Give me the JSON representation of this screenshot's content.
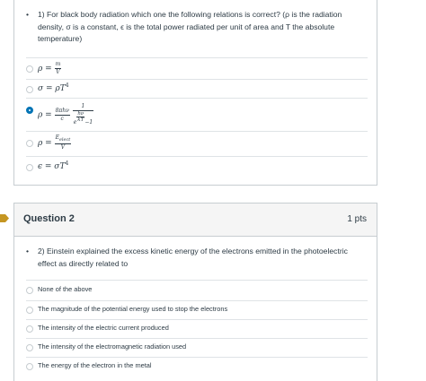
{
  "question1": {
    "bullet": "•",
    "text": "1) For black body radiation which one the following relations is correct? (ρ is the radiation density, σ is a constant, ϵ is the total power radiated per unit of area and T the absolute temperature)",
    "options": [
      {
        "lhs": "ρ =",
        "num": "m",
        "den": "V",
        "selected": false
      },
      {
        "expr": "σ = ρT",
        "sup": "4",
        "selected": false
      },
      {
        "lhs": "ρ =",
        "num1": "8πhν",
        "den1": "c",
        "num2": "1",
        "den2_exp_num": "hν",
        "den2_exp_den": "kT",
        "den2_base": "e",
        "den2_tail": "−1",
        "selected": true
      },
      {
        "lhs": "ρ =",
        "num": "E",
        "num_sub": "elect",
        "den": "V",
        "selected": false
      },
      {
        "expr": "ϵ = σT",
        "sup": "4",
        "selected": false
      }
    ]
  },
  "question2": {
    "title": "Question 2",
    "points": "1 pts",
    "bullet": "•",
    "text": "2) Einstein explained the excess kinetic energy of the electrons emitted in the photoelectric effect as directly related to",
    "options": [
      "None of the above",
      "The magnitude of the potential energy used to stop the electrons",
      "The intensity of the electric current produced",
      "The intensity of the electromagnetic radiation used",
      "The energy of the electron in the metal"
    ]
  },
  "colors": {
    "accent": "#0374b5",
    "flag": "#c59622",
    "border": "#c7cdd1",
    "text": "#2d3b45"
  }
}
